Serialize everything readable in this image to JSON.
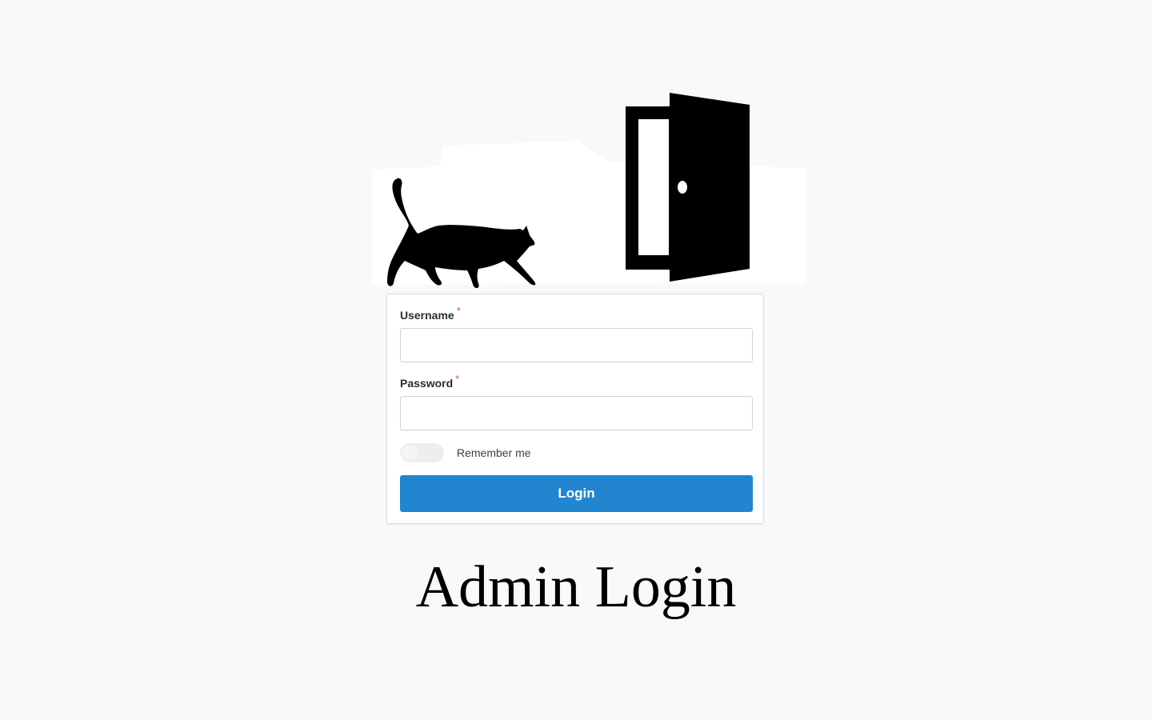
{
  "form": {
    "username_label": "Username",
    "username_required_mark": "*",
    "username_value": "",
    "password_label": "Password",
    "password_required_mark": "*",
    "password_value": "",
    "remember_label": "Remember me",
    "remember_checked": false,
    "login_button_label": "Login"
  },
  "page": {
    "heading": "Admin Login"
  },
  "illustration": {
    "icons": [
      "walking-cat-icon",
      "open-door-icon"
    ]
  },
  "colors": {
    "primary_button": "#2185d0",
    "required_mark": "#d9534f",
    "background": "#f8f9fb"
  }
}
